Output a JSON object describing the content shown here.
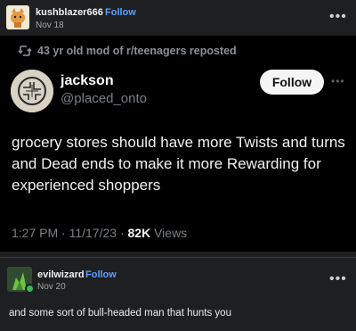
{
  "original_post": {
    "username": "kushblazer666",
    "follow_label": "Follow",
    "date": "Nov 18",
    "more_icon": "more-horizontal-icon"
  },
  "tweet": {
    "repost_text": "43 yr old mod of r/teenagers reposted",
    "display_name": "jackson",
    "handle": "@placed_onto",
    "follow_label": "Follow",
    "body": "grocery stores should have more Twists and turns and Dead ends to make it more Rewarding for experienced shoppers",
    "time": "1:27 PM",
    "separator": "·",
    "date": "11/17/23",
    "views_count": "82K",
    "views_label": "Views"
  },
  "reblog": {
    "username": "evilwizard",
    "follow_label": "Follow",
    "date": "Nov 20",
    "text": "and some sort of bull-headed man that hunts you"
  },
  "colors": {
    "background": "#1e1f21",
    "tweet_background": "#000000",
    "follow_link": "#5aa0ff",
    "muted": "#7a7f84"
  }
}
